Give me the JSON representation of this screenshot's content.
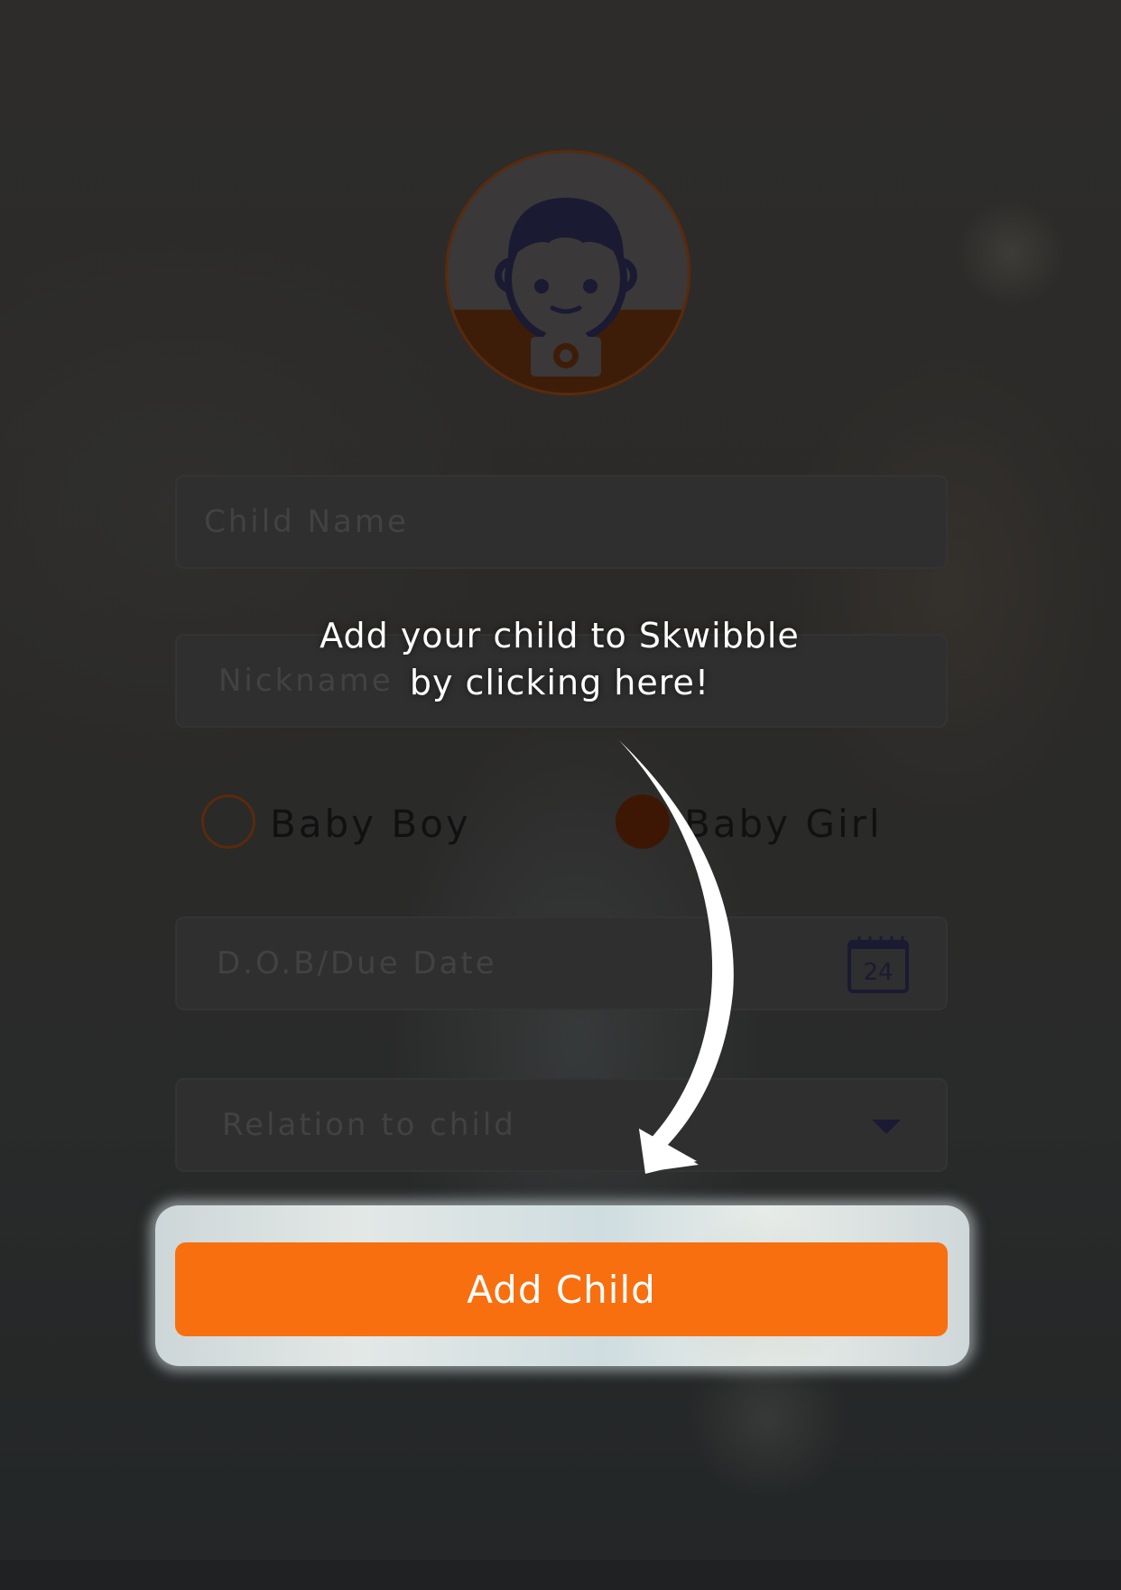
{
  "form": {
    "child_name_placeholder": "Child Name",
    "nickname_placeholder": "Nickname",
    "gender_options": [
      "Baby Boy",
      "Baby Girl"
    ],
    "selected_gender": "Baby Girl",
    "dob_placeholder": "D.O.B/Due Date",
    "calendar_day": "24",
    "relation_placeholder": "Relation to child"
  },
  "coachmark": {
    "line1": "Add your child to Skwibble",
    "line2": "by clicking here!"
  },
  "add_button": {
    "label": "Add Child"
  },
  "colors": {
    "accent": "#f86f10",
    "overlay_dark": "#2a2a29",
    "radio_selected": "#3d1703",
    "icon_navy": "#1a1a33"
  },
  "icons": {
    "avatar": "child-face-icon",
    "camera": "camera-icon",
    "calendar": "calendar-icon",
    "dropdown": "caret-down-icon"
  }
}
